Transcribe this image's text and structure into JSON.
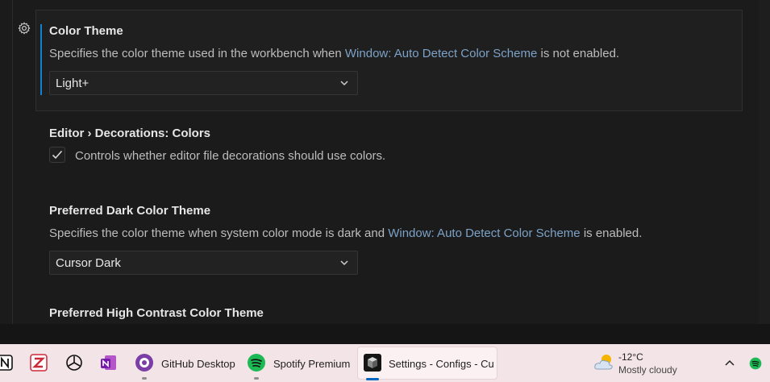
{
  "settings": {
    "color_theme": {
      "title": "Color Theme",
      "desc_before": "Specifies the color theme used in the workbench when ",
      "desc_link": "Window: Auto Detect Color Scheme",
      "desc_after": " is not enabled.",
      "value": "Light+"
    },
    "decorations": {
      "title": "Editor › Decorations: Colors",
      "label": "Controls whether editor file decorations should use colors.",
      "checked": true
    },
    "preferred_dark": {
      "title": "Preferred Dark Color Theme",
      "desc_before": "Specifies the color theme when system color mode is dark and ",
      "desc_link": "Window: Auto Detect Color Scheme",
      "desc_after": " is enabled.",
      "value": "Cursor Dark"
    },
    "preferred_high_contrast": {
      "title": "Preferred High Contrast Color Theme"
    }
  },
  "taskbar": {
    "apps": [
      {
        "icon": "notion-icon"
      },
      {
        "icon": "zotero-icon"
      },
      {
        "icon": "chatgpt-icon"
      },
      {
        "icon": "onenote-icon"
      },
      {
        "icon": "github-desktop-icon",
        "label": "GitHub Desktop"
      },
      {
        "icon": "spotify-icon",
        "label": "Spotify Premium"
      },
      {
        "icon": "cursor-icon",
        "label": "Settings - Configs - Curs",
        "active": true
      }
    ],
    "weather": {
      "temp": "-12°C",
      "condition": "Mostly cloudy",
      "icon": "cloudy-icon"
    },
    "tray": {
      "chevron_icon": "chevron-up-icon",
      "spotify_icon": "spotify-tray-icon"
    }
  },
  "colors": {
    "accent": "#0e82cf",
    "link": "#7ca2c7",
    "taskbar": "#f3e4e7"
  }
}
